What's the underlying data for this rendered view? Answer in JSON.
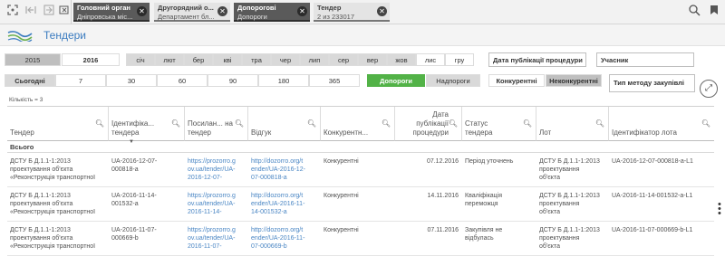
{
  "toolbar": {
    "icons": [
      "smart-search-icon",
      "step-back-icon",
      "step-forward-icon",
      "clear-selections-icon"
    ],
    "right_icons": [
      "search-icon",
      "bookmarks-icon"
    ]
  },
  "selections": [
    {
      "field": "Головний орган",
      "value": "Дніпровська міс..."
    },
    {
      "field": "Другорядний о...",
      "value": "Департамент бл..."
    },
    {
      "field": "Допорогові",
      "value": "Допороги"
    },
    {
      "field": "Тендер",
      "value": "2 из 233017"
    }
  ],
  "header": {
    "title": "Тендери"
  },
  "years": [
    "2015",
    "2016"
  ],
  "months": [
    "січ",
    "лют",
    "бер",
    "кві",
    "тра",
    "чер",
    "лип",
    "сер",
    "вер",
    "жов",
    "лис",
    "гру"
  ],
  "date_pub_label": "Дата публікації процедури",
  "participant_label": "Учасник",
  "method_label": "Тип методу закупівлі",
  "periods": [
    "Сьогодні",
    "7",
    "30",
    "60",
    "90",
    "180",
    "365"
  ],
  "thresholds": [
    "Допороги",
    "Надпороги"
  ],
  "competition": [
    "Конкурентні",
    "Неконкурентні"
  ],
  "count_label": "Кількість = 3",
  "table": {
    "columns": [
      "Тендер",
      "Ідентифіка... тендера",
      "Посилан... на тендер",
      "Відгук",
      "Конкурентн...",
      "Дата публікації процедури",
      "Статус тендера",
      "Лот",
      "Ідентифікатор лота"
    ],
    "total_label": "Всього",
    "rows": [
      {
        "tender": [
          "ДСТУ Б Д.1.1-1:2013",
          "проектування об'єкта",
          "«Реконструкція транспортної"
        ],
        "id": [
          "UA-2016-12-07-",
          "000818-a"
        ],
        "link": [
          "https://prozorro.g",
          "ov.ua/tender/UA-",
          "2016-12-07-"
        ],
        "feedback": [
          "http://dozorro.org/t",
          "ender/UA-2016-12-",
          "07-000818-a"
        ],
        "competitive": "Конкурентні",
        "date": "07.12.2016",
        "status": [
          "Період уточнень"
        ],
        "lot": [
          "ДСТУ Б Д.1.1-1:2013",
          "проектування",
          "об'єкта"
        ],
        "lot_id": "UA-2016-12-07-000818-a-L1"
      },
      {
        "tender": [
          "ДСТУ Б Д.1.1-1:2013",
          "проектування об'єкта",
          "«Реконструкція транспортної"
        ],
        "id": [
          "UA-2016-11-14-",
          "001532-a"
        ],
        "link": [
          "https://prozorro.g",
          "ov.ua/tender/UA-",
          "2016-11-14-"
        ],
        "feedback": [
          "http://dozorro.org/t",
          "ender/UA-2016-11-",
          "14-001532-a"
        ],
        "competitive": "Конкурентні",
        "date": "14.11.2016",
        "status": [
          "Кваліфікація",
          "переможця"
        ],
        "lot": [
          "ДСТУ Б Д.1.1-1:2013",
          "проектування",
          "об'єкта"
        ],
        "lot_id": "UA-2016-11-14-001532-a-L1"
      },
      {
        "tender": [
          "ДСТУ Б Д.1.1-1:2013",
          "проектування об'єкта",
          "«Реконструкція транспортної"
        ],
        "id": [
          "UA-2016-11-07-",
          "000669-b"
        ],
        "link": [
          "https://prozorro.g",
          "ov.ua/tender/UA-",
          "2016-11-07-"
        ],
        "feedback": [
          "http://dozorro.org/t",
          "ender/UA-2016-11-",
          "07-000669-b"
        ],
        "competitive": "Конкурентні",
        "date": "07.11.2016",
        "status": [
          "Закупівля не",
          "відбулась"
        ],
        "lot": [
          "ДСТУ Б Д.1.1-1:2013",
          "проектування",
          "об'єкта"
        ],
        "lot_id": "UA-2016-11-07-000669-b-L1"
      }
    ]
  },
  "colors": {
    "accent": "#3a7bbf",
    "green": "#52b247",
    "chip_dark": "#5a5a5a"
  }
}
